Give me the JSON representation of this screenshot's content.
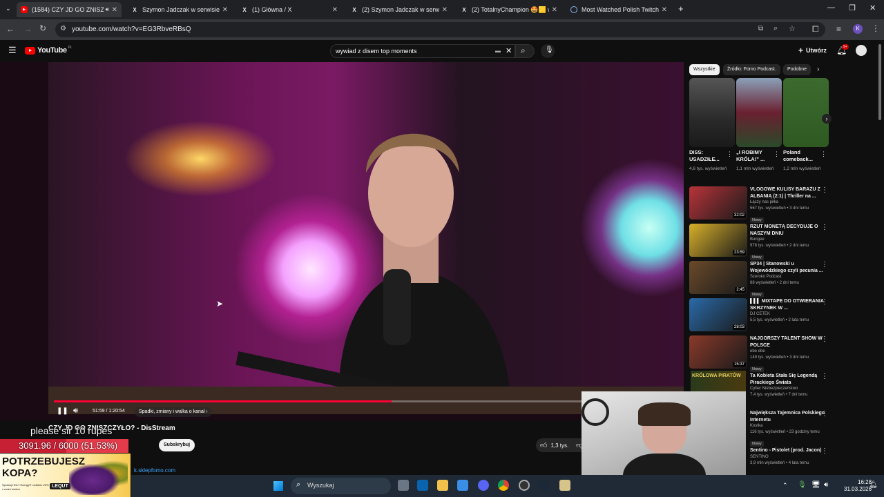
{
  "browser": {
    "tabs": [
      {
        "title": "(1584) CZY JD GO ZNISZCZYŁO",
        "active": true,
        "favicon": "youtube-icon"
      },
      {
        "title": "Szymon Jadczak w serwisie X: ...",
        "favicon": "x-icon"
      },
      {
        "title": "(1) Główna / X",
        "favicon": "x-icon"
      },
      {
        "title": "(2) Szymon Jadczak w serwisie ...",
        "favicon": "x-icon"
      },
      {
        "title": "(2) TotalnyChampion 🤩🟨 w ...",
        "favicon": "x-icon"
      },
      {
        "title": "Most Watched Polish Twitch St...",
        "favicon": "globe-icon"
      }
    ],
    "url": "youtube.com/watch?v=EG3RbveRBsQ",
    "profile_initial": "K"
  },
  "youtube": {
    "logo_text": "YouTube",
    "country_code": "PL",
    "search_value": "wywiad z disem top moments",
    "create_label": "Utwórz",
    "notification_count": "9+",
    "video": {
      "time": "51:59 / 1:20:54",
      "chapter": "Spadki, zmiany i walka o kanał",
      "progress": 0.64,
      "title": "CZY JD GO ZNISZCZYŁO? - DisStream",
      "likes": "1,3 tys.",
      "subscribe_label": "Subskrybuj",
      "desc_link": "k.sklepfomo.com"
    },
    "chips": [
      "Wszystkie",
      "Źródło: Fomo Podcast.",
      "Podobne"
    ],
    "shorts": [
      {
        "title": "DISS: USADZIŁE...",
        "views": "4,6 tys. wyświetleń"
      },
      {
        "title": "„I ROBIMY KRÓLA!” ...",
        "views": "1,1 mln wyświetleń"
      },
      {
        "title": "Poland comeback...",
        "views": "1,2 mln wyświetleń"
      }
    ],
    "recommended": [
      {
        "title": "VLOGOWE KULISY BARAŻU Z ALBANIĄ (2:1) | Thriller na ...",
        "channel": "Łączy nas piłka",
        "meta": "567 tys. wyświetleń • 3 dni temu",
        "badge": "Nowy",
        "duration": "32:02"
      },
      {
        "title": "RZUT MONETĄ DECYDUJE O NASZYM DNIU",
        "channel": "Bungee",
        "meta": "978 tys. wyświetleń • 2 dni temu",
        "badge": "Nowy",
        "duration": "23:59"
      },
      {
        "title": "SP34 | Stanowski u Wojewódzkiego czyli pecunia ...",
        "channel": "Szeroko Podcast",
        "meta": "88 wyświetleń • 2 dni temu",
        "badge": "Nowy",
        "duration": "2:45"
      },
      {
        "title": "▌▌▌ MIXTAPE DO OTWIERANIA SKRZYNEK W ...",
        "channel": "DJ CETEK",
        "meta": "5,5 tys. wyświetleń • 2 lata temu",
        "badge": "",
        "duration": "28:03"
      },
      {
        "title": "NAJGORSZY TALENT SHOW W POLSCE",
        "channel": "ebe ebe",
        "meta": "149 tys. wyświetleń • 3 dni temu",
        "badge": "Nowy",
        "duration": "15:37"
      },
      {
        "title": "Ta Kobieta Stała Się Legendą Pirackiego Świata",
        "channel": "Cyber Niebezpieczeństwo",
        "meta": "7,4 tys. wyświetleń • 7 dni temu",
        "badge": "",
        "duration": ""
      },
      {
        "title": "Największa Tajemnica Polskiego Internetu",
        "channel": "Kostka",
        "meta": "116 tys. wyświetleń • 23 godziny temu",
        "badge": "Nowy",
        "duration": ""
      },
      {
        "title": "Sentino - Pistolet (prod. Jacon)",
        "channel": "SENTINO",
        "meta": "3,9 mln wyświetleń • 4 lata temu",
        "badge": "",
        "duration": ""
      }
    ]
  },
  "stream_overlay": {
    "sub_message": "please sir 10 rupes",
    "goal_text": "3091.96 / 6000 (51.53%)",
    "ad_headline_1": "POTRZEBUJESZ",
    "ad_headline_2": "KOPA?",
    "ad_small": "Spróbuj HOLY Energy® i odbierz 20% z moim kodem",
    "ad_brand": "LEQUT",
    "webcam_thumb_text": "KRÓLOWA PIRATÓW"
  },
  "taskbar": {
    "search_placeholder": "Wyszukaj",
    "time": "16:28",
    "date": "31.03.2026"
  }
}
